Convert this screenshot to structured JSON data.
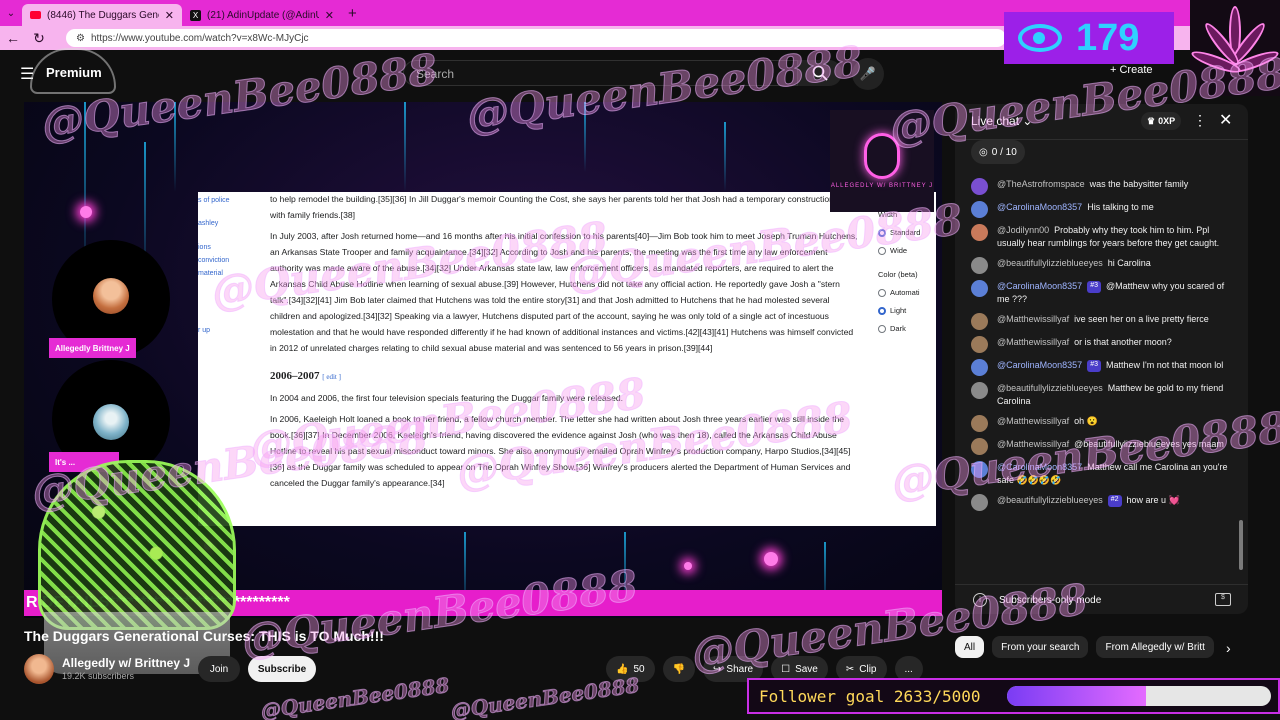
{
  "browser": {
    "tabs": [
      {
        "title": "(8446) The Duggars Generatio",
        "active": true,
        "icon": "youtube-icon"
      },
      {
        "title": "(21) AdinUpdate (@AdinUpdate) /",
        "active": false,
        "icon": "x-icon"
      }
    ],
    "new_tab": "+",
    "url": "https://www.youtube.com/watch?v=x8Wc-MJyCjc"
  },
  "yt": {
    "logo": "Premium",
    "search_placeholder": "Search",
    "create": "Create"
  },
  "doc": {
    "leftnav": [
      "s of police",
      "ashley",
      "ions",
      "conviction",
      "material",
      "r up"
    ],
    "lines1": "to help remodel the building.[35][36] In Jill Duggar's memoir Counting the Cost, she says her parents told her that Josh had a temporary construction job with family friends.[38]",
    "para1": "In July 2003, after Josh returned home—and 16 months after his initial confession to his parents[40]—Jim Bob took him to meet Joseph Truman Hutchens, an Arkansas State Trooper and family acquaintance.[34][32] According to Josh and his parents, the meeting was the first time any law enforcement authority was made aware of the abuse.[34][32] Under Arkansas state law, law enforcement officers, as mandated reporters, are required to alert the Arkansas Child Abuse Hotline when learning of sexual abuse.[39] However, Hutchens did not take any official action. He reportedly gave Josh a \"stern talk\".[34][32][41] Jim Bob later claimed that Hutchens was told the entire story[31] and that Josh admitted to Hutchens that he had molested several children and apologized.[34][32] Speaking via a lawyer, Hutchens disputed part of the account, saying he was only told of a single act of incestuous molestation and that he would have responded differently if he had known of additional instances and victims.[42][43][41] Hutchens was himself convicted in 2012 of unrelated charges relating to child sexual abuse material and was sentenced to 56 years in prison.[39][44]",
    "heading": "2006–2007",
    "edit": "[ edit ]",
    "para2": "In 2004 and 2006, the first four television specials featuring the Duggar family were released.",
    "para3": "In 2006, Kaeleigh Holt loaned a book to her friend, a fellow church member. The letter she had written about Josh three years earlier was still inside the book.[36][37] In December 2006, Kaeleigh's friend, having discovered the evidence against Josh (who was then 18), called the Arkansas Child Abuse Hotline to reveal his past sexual misconduct toward minors. She also anonymously emailed Oprah Winfrey's production company, Harpo Studios,[34][45][36] as the Duggar family was scheduled to appear on The Oprah Winfrey Show.[36] Winfrey's producers alerted the Department of Human Services and canceled the Duggar family's appearance.[34]",
    "rightcol": {
      "width_label": "Width",
      "standard": "Standard",
      "wide": "Wide",
      "color_label": "Color (beta)",
      "automatic": "Automati",
      "light": "Light",
      "dark": "Dark"
    }
  },
  "stream": {
    "guest1": "Allegedly Brittney J",
    "guest2": "It's ...",
    "ticker": "R                    DETAILS*****************************",
    "viewers": "179",
    "follower_goal": "Follower goal 2633/5000",
    "follower_progress": 0.5266,
    "watermark": "@QueenBee0888",
    "pod_logo_text": "ALLEGEDLY W/ BRITTNEY J"
  },
  "video": {
    "title": "The Duggars Generational Curses: THIS is TO Much!!!",
    "channel": "Allegedly w/ Brittney J",
    "subs": "19.2K subscribers",
    "join": "Join",
    "subscribe": "Subscribe",
    "likes": "50",
    "share": "Share",
    "save": "Save",
    "clip": "Clip",
    "more": "..."
  },
  "chat": {
    "title": "Live chat",
    "xp": "0XP",
    "goal": "0 / 10",
    "messages": [
      {
        "author": "@TheAstrofromspace",
        "text": "was the babysitter family",
        "avatar": "#7a4fd1",
        "badge": ""
      },
      {
        "author": "@CarolinaMoon8357",
        "text": "His talking to me",
        "avatar": "#5b7fd6",
        "badge": "",
        "mod": true
      },
      {
        "author": "@Jodilynn00",
        "text": "Probably why they took him to him. Ppl usually hear rumblings for years before they get caught.",
        "avatar": "#c97a5b",
        "badge": ""
      },
      {
        "author": "@beautifullylizzieblueeyes",
        "text": "hi Carolina",
        "avatar": "#8a8a8a",
        "badge": ""
      },
      {
        "author": "@CarolinaMoon8357",
        "text": "@Matthew why you scared of me ???",
        "avatar": "#5b7fd6",
        "badge": "#3",
        "mod": true
      },
      {
        "author": "@Matthewissillyaf",
        "text": "ive seen her on a live pretty fierce",
        "avatar": "#9b7a5a",
        "badge": ""
      },
      {
        "author": "@Matthewissillyaf",
        "text": "or is that another moon?",
        "avatar": "#9b7a5a",
        "badge": ""
      },
      {
        "author": "@CarolinaMoon8357",
        "text": "Matthew I'm not that moon lol",
        "avatar": "#5b7fd6",
        "badge": "#3",
        "mod": true
      },
      {
        "author": "@beautifullylizzieblueeyes",
        "text": "Matthew be gold to my friend Carolina",
        "avatar": "#8a8a8a",
        "badge": ""
      },
      {
        "author": "@Matthewissillyaf",
        "text": "oh 😮",
        "avatar": "#9b7a5a",
        "badge": ""
      },
      {
        "author": "@Matthewissillyaf",
        "text": "@beautifullylizzieblueeyes yes maam",
        "avatar": "#9b7a5a",
        "badge": ""
      },
      {
        "author": "@CarolinaMoon8357",
        "text": "Matthew call me Carolina an you're safe 🤣🤣🤣🤣",
        "avatar": "#5b7fd6",
        "badge": "",
        "mod": true
      },
      {
        "author": "@beautifullylizzieblueeyes",
        "text": "how are u 💓",
        "avatar": "#8a8a8a",
        "badge": "#2"
      }
    ],
    "subscribers_only": "Subscribers-only mode"
  },
  "chips": [
    "All",
    "From your search",
    "From Allegedly w/ Britt"
  ],
  "colors": {
    "accent_pink": "#e52bd4",
    "viewer_blue": "#2fd1ff",
    "goal_yellow": "#ffd95a"
  }
}
